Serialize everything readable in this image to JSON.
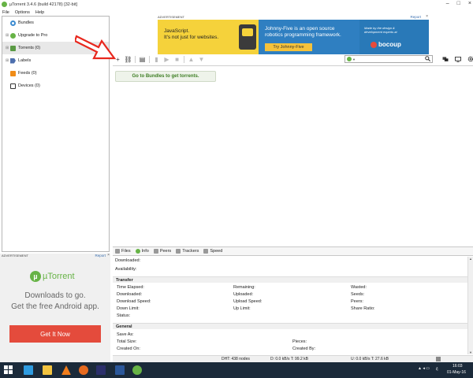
{
  "window": {
    "title": "µTorrent 3.4.6  (build 42178) [32-bit]"
  },
  "menu": [
    "File",
    "Options",
    "Help"
  ],
  "sidebar": {
    "items": [
      {
        "label": "Bundles"
      },
      {
        "label": "Upgrade to Pro"
      },
      {
        "label": "Torrents (0)"
      },
      {
        "label": "Labels"
      },
      {
        "label": "Feeds (0)"
      },
      {
        "label": "Devices (0)"
      }
    ]
  },
  "ads": {
    "label": "ADVERTISEMENT",
    "report": "Report",
    "close": "×",
    "banner": {
      "js_line1": "JavaScript.",
      "js_line2": "It's not just for websites.",
      "mid_line1": "Johnny-Five is an open source",
      "mid_line2": "robotics programming framework.",
      "button": "Try Johnny-Five",
      "right_line1": "Made by the design &",
      "right_line2": "development experts at",
      "brand": "bocoup"
    },
    "side": {
      "logo": "µTorrent",
      "line1": "Downloads to go.",
      "line2": "Get the free Android app.",
      "button": "Get It Now"
    }
  },
  "toolbar": {
    "add": "+",
    "link": "⛓",
    "create": "▤",
    "remove": "▮",
    "start": "▶",
    "stop": "■",
    "up": "▲",
    "down": "▼",
    "search_icon": "🔍"
  },
  "main": {
    "bundles_banner": "Go to Bundles to get torrents."
  },
  "tabs": [
    {
      "label": "Files"
    },
    {
      "label": "Info"
    },
    {
      "label": "Peers"
    },
    {
      "label": "Trackers"
    },
    {
      "label": "Speed"
    }
  ],
  "details": {
    "downloaded_label": "Downloaded:",
    "availability_label": "Availability:",
    "transfer_header": "Transfer",
    "transfer": {
      "col1": [
        "Time Elapsed:",
        "Downloaded:",
        "Download Speed:",
        "Down Limit:",
        "Status:"
      ],
      "col2": [
        "Remaining:",
        "Uploaded:",
        "Upload Speed:",
        "Up Limit:"
      ],
      "col3": [
        "Wasted:",
        "Seeds:",
        "Peers:",
        "Share Ratio:"
      ]
    },
    "general_header": "General",
    "general": {
      "col1": [
        "Save As:",
        "Total Size:",
        "Created On:"
      ],
      "col2": [
        "Pieces:",
        "Created By:"
      ]
    }
  },
  "status": {
    "dht": "DHT: 438 nodes",
    "down": "D: 0.0 kB/s T: 99.2 kB",
    "up": "U: 0.0 kB/s T: 27.6 kB"
  },
  "taskbar": {
    "time": "16:03",
    "date": "01-May-16",
    "lang": "ﻉ"
  },
  "colors": {
    "accent": "#67b346",
    "banner_yellow": "#f5d23b",
    "banner_blue": "#2f7fc1",
    "ad_red": "#e44b3c",
    "taskbar": "#1b2a3a"
  }
}
